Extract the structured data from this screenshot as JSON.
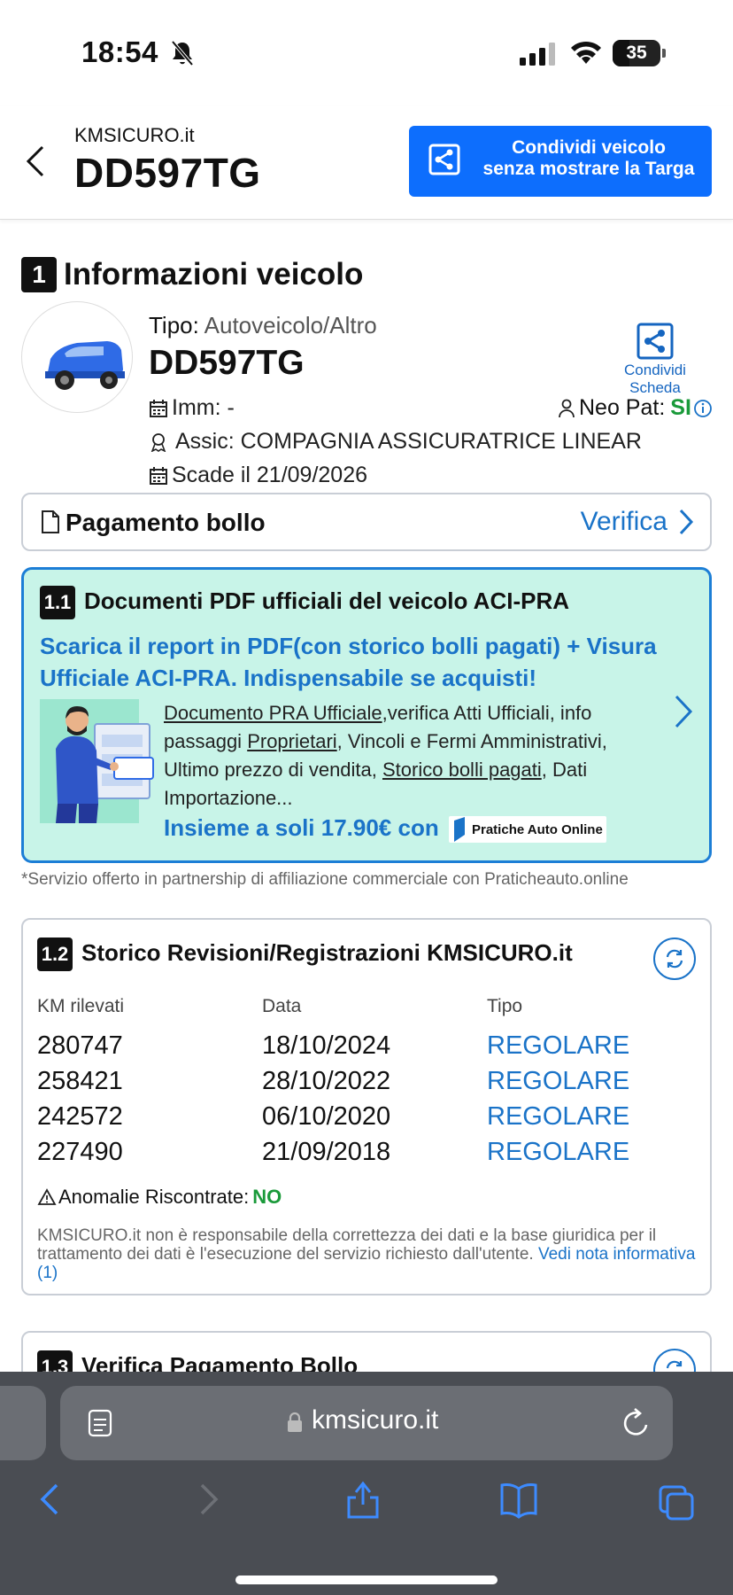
{
  "status_bar": {
    "time": "18:54",
    "battery_level": "35",
    "battery_fraction": 0.35
  },
  "header": {
    "site": "KMSICURO.it",
    "plate": "DD597TG",
    "share_button_line1": "Condividi veicolo",
    "share_button_line2": "senza mostrare la Targa"
  },
  "section1": {
    "number": "1",
    "title": "Informazioni veicolo",
    "tipo_label": "Tipo:",
    "tipo_value": "Autoveicolo/Altro",
    "plate": "DD597TG",
    "share_label": "Condividi Scheda",
    "imm": "Imm: -",
    "neopat_label": "Neo Pat:",
    "neopat_value": "SI",
    "assic": "Assic: COMPAGNIA ASSICURATRICE LINEAR",
    "scade": "Scade il 21/09/2026",
    "bollo_label": "Pagamento bollo",
    "bollo_action": "Verifica"
  },
  "section_pdf": {
    "number": "1.1",
    "title": "Documenti PDF ufficiali del veicolo ACI-PRA",
    "subtitle": "Scarica il report in PDF(con storico bolli pagati) + Visura Ufficiale ACI-PRA. Indispensabile se acquisti!",
    "desc_link1": "Documento PRA Ufficiale",
    "desc_text1": ",verifica Atti Ufficiali, info passaggi ",
    "desc_link2": "Proprietari",
    "desc_text2": ", Vincoli e Fermi Amministrativi, Ultimo prezzo di vendita, ",
    "desc_link3": "Storico bolli pagati",
    "desc_text3": ", Dati Importazione...",
    "price": "Insieme a soli 17.90€ con",
    "partner_logo_text": "Pratiche Auto Online"
  },
  "partner_note": "*Servizio offerto in partnership di affiliazione commerciale con Praticheauto.online",
  "section_rev": {
    "number": "1.2",
    "title": "Storico Revisioni/Registrazioni KMSICURO.it",
    "columns": [
      "KM rilevati",
      "Data",
      "Tipo"
    ],
    "rows": [
      {
        "km": "280747",
        "date": "18/10/2024",
        "type": "REGOLARE"
      },
      {
        "km": "258421",
        "date": "28/10/2022",
        "type": "REGOLARE"
      },
      {
        "km": "242572",
        "date": "06/10/2020",
        "type": "REGOLARE"
      },
      {
        "km": "227490",
        "date": "21/09/2018",
        "type": "REGOLARE"
      }
    ],
    "anomalie_label": "Anomalie Riscontrate:",
    "anomalie_value": "NO",
    "disclaimer": "KMSICURO.it non è responsabile della correttezza dei dati e la base giuridica per il trattamento dei dati è l'esecuzione del servizio richiesto dall'utente.",
    "disclaimer_link": "Vedi nota informativa (1)"
  },
  "section_bollo": {
    "number": "1.3",
    "title": "Verifica Pagamento Bollo"
  },
  "browser": {
    "url": "kmsicuro.it"
  },
  "colors": {
    "primary_blue": "#0d6efd",
    "link_blue": "#1a73c8",
    "success_green": "#1a9a3a",
    "pdf_card_bg": "#c8f4e8"
  }
}
